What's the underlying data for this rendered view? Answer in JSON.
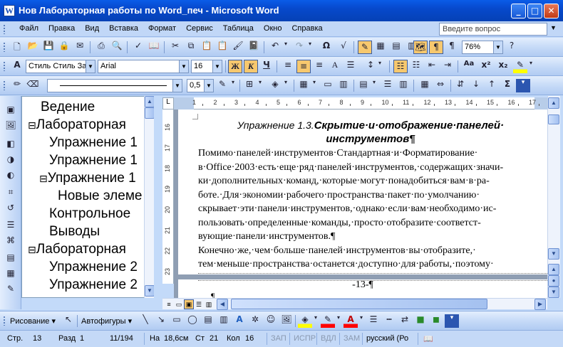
{
  "window": {
    "title": "Нов Лабораторная работы по Word_печ - Microsoft Word",
    "app_icon": "W",
    "minimize_glyph": "_",
    "maximize_glyph": "□",
    "close_glyph": "✕"
  },
  "menu": {
    "items": [
      "Файл",
      "Правка",
      "Вид",
      "Вставка",
      "Формат",
      "Сервис",
      "Таблица",
      "Окно",
      "Справка"
    ],
    "ask_placeholder": "Введите вопрос"
  },
  "standard_toolbar": {
    "zoom": "76%",
    "omega_glyph": "Ω"
  },
  "formatting_toolbar": {
    "style": "Стиль Стиль За",
    "font": "Arial",
    "size": "16",
    "bold": "Ж",
    "italic": "К",
    "underline": "Ч",
    "font_color_glyph": "A",
    "superscript": "x²",
    "subscript": "x₂",
    "change_case": "Aa"
  },
  "tables_toolbar": {
    "line_weight": "0,5"
  },
  "document_map": {
    "items": [
      {
        "toggle": "",
        "label": "Ведение"
      },
      {
        "toggle": "⊟",
        "label": "Лабораторная"
      },
      {
        "toggle": "",
        "label": "Упражнение 1"
      },
      {
        "toggle": "",
        "label": "Упражнение 1"
      },
      {
        "toggle": "⊟",
        "label": "Упражнение 1"
      },
      {
        "toggle": "",
        "label": "Новые элеме"
      },
      {
        "toggle": "",
        "label": "Контрольное"
      },
      {
        "toggle": "",
        "label": "Выводы"
      },
      {
        "toggle": "⊟",
        "label": "Лабораторная"
      },
      {
        "toggle": "",
        "label": "Упражнение 2"
      },
      {
        "toggle": "",
        "label": "Упражнение 2"
      }
    ]
  },
  "ruler": {
    "h_numbers": [
      "1",
      "2",
      "3",
      "4",
      "5",
      "6",
      "7",
      "8",
      "9",
      "10",
      "11",
      "12",
      "13",
      "14",
      "15",
      "16",
      "17"
    ],
    "v_numbers": [
      "16",
      "17",
      "18",
      "19",
      "20",
      "21",
      "22",
      "23"
    ],
    "corner_glyph": "L"
  },
  "document": {
    "heading_prefix": "Упражнение 1.3.",
    "heading_bold_line1": "Скрытие·и·отображение·панелей·",
    "heading_bold_line2": "инструментов¶",
    "lines": [
      "        Помимо·панелей·инструментов·Стандартная·и·Форматирование·",
      "в·Office·2003·есть·еще·ряд·панелей·инструментов,·содержащих·значи-",
      "ки·дополнительных·команд,·которые·могут·понадобиться·вам·в·ра-",
      "боте.·Для·экономии·рабочего·пространства·пакет·по·умолчанию·",
      "скрывает·эти·панели·инструментов,·однако·если·вам·необходимо·ис-",
      "пользовать·определенные·команды,·просто·отобразите·соответст-",
      "вующие·панели·инструментов.¶",
      "        Конечно·же,·чем·больше·панелей·инструментов·вы·отобразите,·",
      "тем·меньше·пространства·останется·доступно·для·работы,·поэтому·"
    ],
    "last_line": "вующие·панели·инструментов.¶",
    "page_number": "-13-¶",
    "pilcrow": "¶"
  },
  "drawing_toolbar": {
    "draw_label": "Рисование",
    "autoshapes_label": "Автофигуры"
  },
  "status": {
    "page": "Стр.",
    "page_num": "13",
    "section": "Разд",
    "section_num": "1",
    "pages": "11/194",
    "at": "На",
    "at_val": "18,6см",
    "line": "Ст",
    "line_val": "21",
    "col": "Кол",
    "col_val": "16",
    "rec": "ЗАП",
    "trk": "ИСПР",
    "ext": "ВДЛ",
    "ovr": "ЗАМ",
    "language": "русский (Ро"
  }
}
